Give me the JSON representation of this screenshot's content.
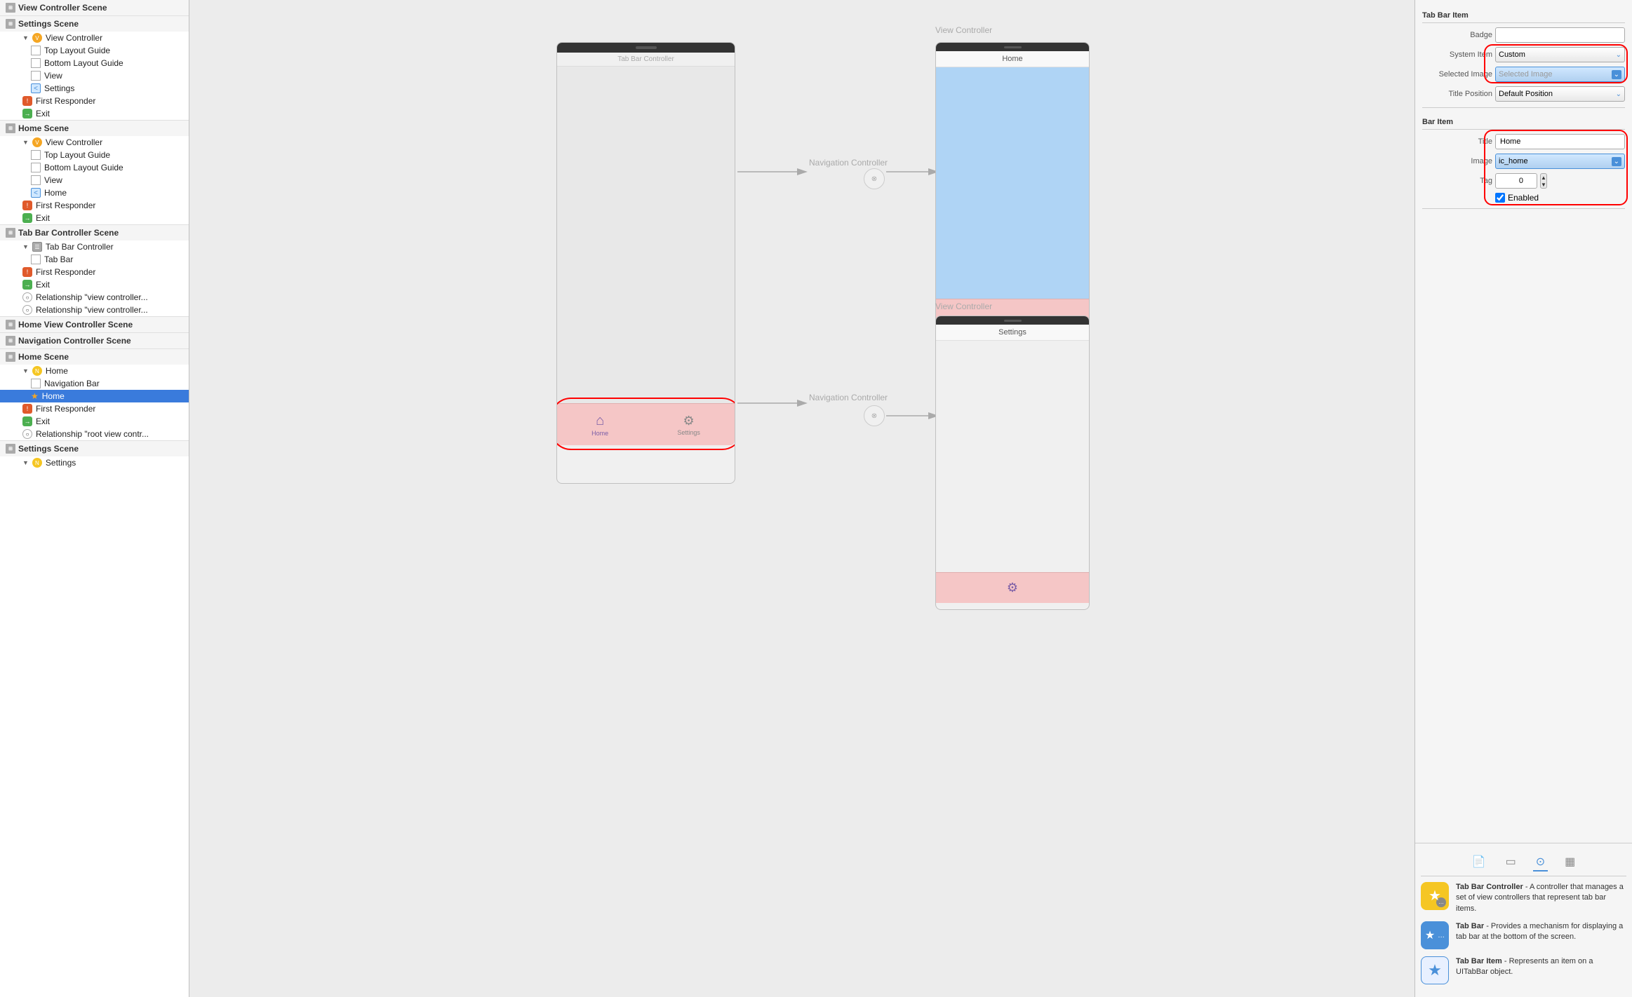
{
  "left_panel": {
    "scenes": [
      {
        "name": "View Controller Scene",
        "icon": "grid",
        "children": []
      },
      {
        "name": "Settings Scene",
        "icon": "grid",
        "children": [
          {
            "indent": 2,
            "type": "orange",
            "label": "View Controller",
            "caret": "▼"
          },
          {
            "indent": 3,
            "type": "box",
            "label": "Top Layout Guide"
          },
          {
            "indent": 3,
            "type": "box",
            "label": "Bottom Layout Guide"
          },
          {
            "indent": 3,
            "type": "box",
            "label": "View"
          },
          {
            "indent": 3,
            "type": "nav",
            "label": "Settings"
          },
          {
            "indent": 2,
            "type": "red",
            "label": "First Responder"
          },
          {
            "indent": 2,
            "type": "green",
            "label": "Exit"
          }
        ]
      },
      {
        "name": "Home Scene",
        "icon": "grid",
        "children": [
          {
            "indent": 2,
            "type": "orange",
            "label": "View Controller",
            "caret": "▼"
          },
          {
            "indent": 3,
            "type": "box",
            "label": "Top Layout Guide"
          },
          {
            "indent": 3,
            "type": "box",
            "label": "Bottom Layout Guide"
          },
          {
            "indent": 3,
            "type": "box",
            "label": "View"
          },
          {
            "indent": 3,
            "type": "nav",
            "label": "Home"
          },
          {
            "indent": 2,
            "type": "red",
            "label": "First Responder"
          },
          {
            "indent": 2,
            "type": "green",
            "label": "Exit"
          }
        ]
      },
      {
        "name": "Tab Bar Controller Scene",
        "icon": "grid",
        "children": [
          {
            "indent": 2,
            "type": "tabbar",
            "label": "Tab Bar Controller",
            "caret": "▼"
          },
          {
            "indent": 3,
            "type": "box",
            "label": "Tab Bar"
          },
          {
            "indent": 2,
            "type": "red",
            "label": "First Responder"
          },
          {
            "indent": 2,
            "type": "green",
            "label": "Exit"
          },
          {
            "indent": 2,
            "type": "circle",
            "label": "Relationship \"view controller..."
          },
          {
            "indent": 2,
            "type": "circle",
            "label": "Relationship \"view controller..."
          }
        ]
      },
      {
        "name": "Home View Controller Scene",
        "icon": "grid",
        "children": []
      },
      {
        "name": "Navigation Controller Scene",
        "icon": "grid",
        "children": []
      },
      {
        "name": "Home Scene",
        "icon": "grid",
        "children": [
          {
            "indent": 2,
            "type": "yellow",
            "label": "Home",
            "caret": "▼"
          },
          {
            "indent": 3,
            "type": "box",
            "label": "Navigation Bar"
          },
          {
            "indent": 3,
            "type": "star",
            "label": "Home",
            "selected": true
          },
          {
            "indent": 2,
            "type": "red",
            "label": "First Responder"
          },
          {
            "indent": 2,
            "type": "green",
            "label": "Exit"
          },
          {
            "indent": 2,
            "type": "circle",
            "label": "Relationship \"root view contr..."
          }
        ]
      },
      {
        "name": "Settings Scene",
        "icon": "grid",
        "children": [
          {
            "indent": 2,
            "type": "yellow",
            "label": "Settings",
            "caret": "▼"
          }
        ]
      }
    ]
  },
  "canvas": {
    "tab_bar_controller_label": "Tab Bar Controller",
    "navigation_controller_label": "Navigation Controller",
    "device_home_title": "Home",
    "device_settings_title": "Settings",
    "device_vc_title": "View Controller",
    "tab_home_label": "Home",
    "tab_settings_label": "Settings"
  },
  "right_panel": {
    "section_tab_bar_item": "Tab Bar Item",
    "badge_label": "Badge",
    "badge_value": "",
    "system_item_label": "System Item",
    "system_item_value": "Custom",
    "selected_image_label": "Selected Image",
    "selected_image_value": "Selected Image",
    "title_position_label": "Title Position",
    "title_position_value": "Default Position",
    "section_bar_item": "Bar Item",
    "title_label": "Title",
    "title_value": "Home",
    "image_label": "Image",
    "image_value": "ic_home",
    "tag_label": "Tag",
    "tag_value": "0",
    "enabled_label": "Enabled",
    "enabled_checked": true,
    "icon_tabs": [
      "doc",
      "view",
      "circle-dot",
      "table"
    ],
    "info_items": [
      {
        "id": "tab-bar-controller",
        "icon_type": "yellow",
        "icon_symbol": "☆",
        "title": "Tab Bar Controller",
        "desc": " - A controller that manages a set of view controllers that represent tab bar items."
      },
      {
        "id": "tab-bar",
        "icon_type": "blue",
        "icon_symbol": "★",
        "title": "Tab Bar",
        "desc": " - Provides a mechanism for displaying a tab bar at the bottom of the screen."
      },
      {
        "id": "tab-bar-item",
        "icon_type": "blue-outline",
        "icon_symbol": "★",
        "title": "Tab Bar Item",
        "desc": " - Represents an item on a UITabBar object."
      }
    ]
  }
}
